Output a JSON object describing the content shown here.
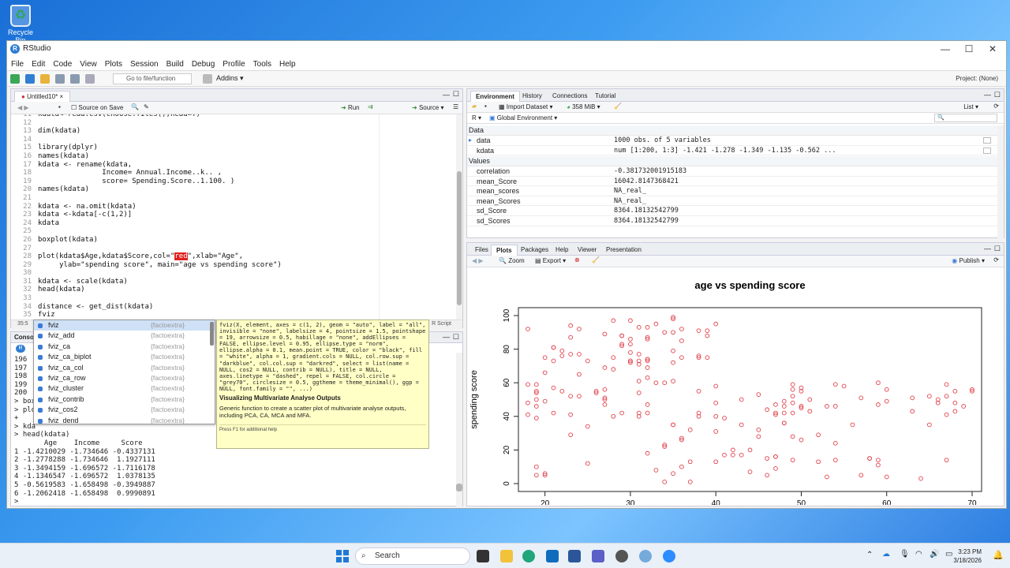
{
  "desktop": {
    "recycle_label": "Recycle Bin"
  },
  "window": {
    "title": "RStudio"
  },
  "menu": [
    "File",
    "Edit",
    "Code",
    "View",
    "Plots",
    "Session",
    "Build",
    "Debug",
    "Profile",
    "Tools",
    "Help"
  ],
  "toolbar": {
    "goto_placeholder": "Go to file/function",
    "addins": "Addins",
    "project": "Project: (None)"
  },
  "editor": {
    "tab": "Untitled10*",
    "source_on_save": "Source on Save",
    "run": "Run",
    "source": "Source",
    "lines": [
      {
        "n": "11",
        "t": "kdata<-read.csv(choose.files(),head=T)"
      },
      {
        "n": "12",
        "t": ""
      },
      {
        "n": "13",
        "t": "dim(kdata)"
      },
      {
        "n": "14",
        "t": ""
      },
      {
        "n": "15",
        "t": "library(dplyr)"
      },
      {
        "n": "16",
        "t": "names(kdata)"
      },
      {
        "n": "17",
        "t": "kdata <- rename(kdata,"
      },
      {
        "n": "18",
        "t": "               Income= Annual.Income..k.. ,"
      },
      {
        "n": "19",
        "t": "               score= Spending.Score..1.100. )"
      },
      {
        "n": "20",
        "t": "names(kdata)"
      },
      {
        "n": "21",
        "t": ""
      },
      {
        "n": "22",
        "t": "kdata <- na.omit(kdata)"
      },
      {
        "n": "23",
        "t": "kdata <-kdata[-c(1,2)]"
      },
      {
        "n": "24",
        "t": "kdata"
      },
      {
        "n": "25",
        "t": ""
      },
      {
        "n": "26",
        "t": "boxplot(kdata)"
      },
      {
        "n": "27",
        "t": ""
      },
      {
        "n": "28a",
        "t": "plot(kdata$Age,kdata$Score,col=\""
      },
      {
        "n": "29",
        "t": "     ylab=\"spending score\", main=\"age vs spending score\")"
      },
      {
        "n": "30",
        "t": ""
      },
      {
        "n": "31",
        "t": "kdata <- scale(kdata)"
      },
      {
        "n": "32",
        "t": "head(kdata)"
      },
      {
        "n": "33",
        "t": ""
      },
      {
        "n": "34",
        "t": "distance <- get_dist(kdata)"
      },
      {
        "n": "35",
        "t": "fviz"
      }
    ],
    "line28": {
      "num": "28",
      "pre": "plot(kdata$Age,kdata$Score,col=\"",
      "hl": "red",
      "post": "\",xlab=\"Age\","
    },
    "status_pos": "35:5",
    "status_type": "R Script"
  },
  "console": {
    "label": "Console",
    "lines": [
      "196",
      "197",
      "198",
      "199",
      "200",
      "> box",
      "> plo",
      "+",
      "> kda",
      "> head(kdata)",
      "       Age    Income     Score",
      "1 -1.4210029 -1.734646 -0.4337131",
      "2 -1.2778288 -1.734646  1.1927111",
      "3 -1.3494159 -1.696572 -1.7116178",
      "4 -1.1346547 -1.696572  1.0378135",
      "5 -0.5619583 -1.658498 -0.3949887",
      "6 -1.2062418 -1.658498  0.9990891",
      ">"
    ]
  },
  "autocomplete": {
    "items": [
      {
        "name": "fviz",
        "pkg": "{factoextra}"
      },
      {
        "name": "fviz_add",
        "pkg": "{factoextra}"
      },
      {
        "name": "fviz_ca",
        "pkg": "{factoextra}"
      },
      {
        "name": "fviz_ca_biplot",
        "pkg": "{factoextra}"
      },
      {
        "name": "fviz_ca_col",
        "pkg": "{factoextra}"
      },
      {
        "name": "fviz_ca_row",
        "pkg": "{factoextra}"
      },
      {
        "name": "fviz_cluster",
        "pkg": "{factoextra}"
      },
      {
        "name": "fviz_contrib",
        "pkg": "{factoextra}"
      },
      {
        "name": "fviz_cos2",
        "pkg": "{factoextra}"
      },
      {
        "name": "fviz_dend",
        "pkg": "{factoextra}"
      }
    ],
    "tip_signature": "fviz(X, element, axes = c(1, 2), geom = \"auto\", label = \"all\", invisible = \"none\", labelsize = 4, pointsize = 1.5, pointshape = 19, arrowsize = 0.5, habillage = \"none\", addEllipses = FALSE, ellipse.level = 0.95, ellipse.type = \"norm\", ellipse.alpha = 0.1, mean.point = TRUE, color = \"black\", fill = \"white\", alpha = 1, gradient.cols = NULL, col.row.sup = \"darkblue\", col.col.sup = \"darkred\", select = list(name = NULL, cos2 = NULL, contrib = NULL), title = NULL, axes.linetype = \"dashed\", repel = FALSE, col.circle = \"grey70\", circlesize = 0.5, ggtheme = theme_minimal(), ggp = NULL, font.family = \"\", ...)",
    "tip_title": "Visualizing Multivariate Analyse Outputs",
    "tip_desc": "Generic function to create a scatter plot of multivariate analyse outputs, including PCA, CA, MCA and MFA.",
    "tip_help": "Press F1 for additional help"
  },
  "env": {
    "tabs": [
      "Environment",
      "History",
      "Connections",
      "Tutorial"
    ],
    "import": "Import Dataset",
    "memory": "358 MiB",
    "list": "List",
    "r": "R",
    "global": "Global Environment",
    "data_head": "Data",
    "values_head": "Values",
    "data": [
      {
        "name": "data",
        "value": "1000 obs. of 5 variables"
      },
      {
        "name": "kdata",
        "value": "num [1:200, 1:3] -1.421 -1.278 -1.349 -1.135 -0.562 ..."
      }
    ],
    "values": [
      {
        "name": "correlation",
        "value": "-0.381732001915183"
      },
      {
        "name": "mean_Score",
        "value": "16042.8147368421"
      },
      {
        "name": "mean_scores",
        "value": "NA_real_"
      },
      {
        "name": "mean_Scores",
        "value": "NA_real_"
      },
      {
        "name": "sd_Score",
        "value": "8364.18132542799"
      },
      {
        "name": "sd_Scores",
        "value": "8364.18132542799"
      }
    ]
  },
  "plots_pane": {
    "tabs": [
      "Files",
      "Plots",
      "Packages",
      "Help",
      "Viewer",
      "Presentation"
    ],
    "zoom": "Zoom",
    "export": "Export",
    "publish": "Publish"
  },
  "chart_data": {
    "type": "scatter",
    "title": "age vs spending score",
    "xlabel": "Age",
    "ylabel": "spending score",
    "xlim": [
      18,
      70
    ],
    "ylim": [
      0,
      100
    ],
    "xticks": [
      20,
      30,
      40,
      50,
      60,
      70
    ],
    "yticks": [
      0,
      20,
      40,
      60,
      80,
      100
    ],
    "grid": false,
    "color": "#e0404a",
    "points": [
      [
        19,
        39
      ],
      [
        21,
        81
      ],
      [
        20,
        6
      ],
      [
        23,
        77
      ],
      [
        31,
        40
      ],
      [
        22,
        76
      ],
      [
        35,
        6
      ],
      [
        23,
        94
      ],
      [
        64,
        3
      ],
      [
        30,
        72
      ],
      [
        67,
        14
      ],
      [
        35,
        99
      ],
      [
        58,
        15
      ],
      [
        24,
        77
      ],
      [
        37,
        13
      ],
      [
        22,
        79
      ],
      [
        35,
        35
      ],
      [
        20,
        66
      ],
      [
        52,
        29
      ],
      [
        35,
        98
      ],
      [
        35,
        35
      ],
      [
        25,
        73
      ],
      [
        46,
        5
      ],
      [
        31,
        73
      ],
      [
        54,
        14
      ],
      [
        29,
        82
      ],
      [
        45,
        32
      ],
      [
        35,
        61
      ],
      [
        40,
        31
      ],
      [
        23,
        87
      ],
      [
        60,
        4
      ],
      [
        21,
        73
      ],
      [
        53,
        4
      ],
      [
        18,
        92
      ],
      [
        49,
        14
      ],
      [
        21,
        81
      ],
      [
        42,
        17
      ],
      [
        30,
        73
      ],
      [
        36,
        26
      ],
      [
        20,
        75
      ],
      [
        65,
        35
      ],
      [
        24,
        92
      ],
      [
        48,
        36
      ],
      [
        31,
        61
      ],
      [
        49,
        28
      ],
      [
        24,
        65
      ],
      [
        50,
        55
      ],
      [
        27,
        47
      ],
      [
        29,
        42
      ],
      [
        31,
        42
      ],
      [
        49,
        52
      ],
      [
        33,
        60
      ],
      [
        31,
        54
      ],
      [
        59,
        60
      ],
      [
        50,
        45
      ],
      [
        47,
        41
      ],
      [
        51,
        50
      ],
      [
        69,
        46
      ],
      [
        27,
        51
      ],
      [
        53,
        46
      ],
      [
        70,
        56
      ],
      [
        19,
        55
      ],
      [
        67,
        52
      ],
      [
        54,
        59
      ],
      [
        63,
        51
      ],
      [
        18,
        59
      ],
      [
        43,
        50
      ],
      [
        68,
        48
      ],
      [
        19,
        59
      ],
      [
        32,
        47
      ],
      [
        70,
        55
      ],
      [
        47,
        42
      ],
      [
        60,
        49
      ],
      [
        60,
        56
      ],
      [
        59,
        47
      ],
      [
        26,
        54
      ],
      [
        45,
        53
      ],
      [
        40,
        48
      ],
      [
        23,
        52
      ],
      [
        49,
        42
      ],
      [
        57,
        51
      ],
      [
        38,
        55
      ],
      [
        67,
        41
      ],
      [
        46,
        44
      ],
      [
        21,
        57
      ],
      [
        48,
        46
      ],
      [
        55,
        58
      ],
      [
        22,
        55
      ],
      [
        34,
        60
      ],
      [
        50,
        46
      ],
      [
        68,
        55
      ],
      [
        18,
        41
      ],
      [
        48,
        49
      ],
      [
        40,
        40
      ],
      [
        32,
        42
      ],
      [
        24,
        52
      ],
      [
        47,
        47
      ],
      [
        27,
        50
      ],
      [
        48,
        42
      ],
      [
        20,
        49
      ],
      [
        23,
        41
      ],
      [
        49,
        48
      ],
      [
        67,
        59
      ],
      [
        26,
        55
      ],
      [
        49,
        56
      ],
      [
        21,
        42
      ],
      [
        66,
        50
      ],
      [
        54,
        46
      ],
      [
        68,
        43
      ],
      [
        66,
        48
      ],
      [
        65,
        52
      ],
      [
        19,
        54
      ],
      [
        38,
        42
      ],
      [
        19,
        46
      ],
      [
        18,
        48
      ],
      [
        19,
        50
      ],
      [
        63,
        43
      ],
      [
        49,
        59
      ],
      [
        51,
        43
      ],
      [
        50,
        57
      ],
      [
        27,
        56
      ],
      [
        38,
        40
      ],
      [
        40,
        58
      ],
      [
        39,
        91
      ],
      [
        23,
        29
      ],
      [
        31,
        77
      ],
      [
        43,
        35
      ],
      [
        40,
        95
      ],
      [
        59,
        11
      ],
      [
        38,
        75
      ],
      [
        47,
        9
      ],
      [
        39,
        75
      ],
      [
        25,
        34
      ],
      [
        31,
        71
      ],
      [
        20,
        5
      ],
      [
        29,
        88
      ],
      [
        44,
        7
      ],
      [
        32,
        73
      ],
      [
        19,
        10
      ],
      [
        35,
        72
      ],
      [
        57,
        5
      ],
      [
        32,
        93
      ],
      [
        28,
        40
      ],
      [
        32,
        87
      ],
      [
        25,
        12
      ],
      [
        28,
        97
      ],
      [
        48,
        36
      ],
      [
        32,
        74
      ],
      [
        34,
        22
      ],
      [
        34,
        90
      ],
      [
        43,
        17
      ],
      [
        39,
        88
      ],
      [
        44,
        20
      ],
      [
        38,
        76
      ],
      [
        47,
        16
      ],
      [
        27,
        89
      ],
      [
        37,
        1
      ],
      [
        30,
        78
      ],
      [
        34,
        1
      ],
      [
        30,
        73
      ],
      [
        56,
        35
      ],
      [
        29,
        83
      ],
      [
        19,
        5
      ],
      [
        31,
        93
      ],
      [
        50,
        26
      ],
      [
        36,
        75
      ],
      [
        42,
        20
      ],
      [
        33,
        95
      ],
      [
        36,
        27
      ],
      [
        32,
        63
      ],
      [
        40,
        13
      ],
      [
        28,
        75
      ],
      [
        36,
        10
      ],
      [
        36,
        92
      ],
      [
        52,
        13
      ],
      [
        30,
        86
      ],
      [
        58,
        15
      ],
      [
        27,
        69
      ],
      [
        59,
        14
      ],
      [
        35,
        90
      ],
      [
        37,
        32
      ],
      [
        32,
        86
      ],
      [
        46,
        15
      ],
      [
        29,
        88
      ],
      [
        41,
        39
      ],
      [
        30,
        97
      ],
      [
        54,
        24
      ],
      [
        28,
        68
      ],
      [
        41,
        17
      ],
      [
        36,
        85
      ],
      [
        34,
        23
      ],
      [
        32,
        69
      ],
      [
        33,
        8
      ],
      [
        38,
        91
      ],
      [
        47,
        16
      ],
      [
        35,
        79
      ],
      [
        45,
        28
      ],
      [
        32,
        74
      ],
      [
        32,
        18
      ],
      [
        30,
        83
      ]
    ]
  },
  "taskbar": {
    "search": "Search",
    "time": "3:23 PM",
    "date": "3/18/2026"
  }
}
